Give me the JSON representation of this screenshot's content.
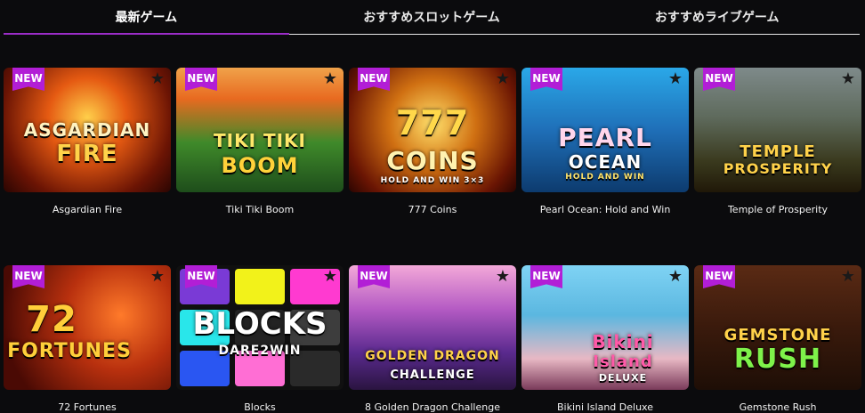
{
  "tabs": [
    {
      "label": "最新ゲーム",
      "active": true
    },
    {
      "label": "おすすめスロットゲーム",
      "active": false
    },
    {
      "label": "おすすめライブゲーム",
      "active": false
    }
  ],
  "badge_label": "NEW",
  "favorite_icon": "star-icon",
  "games": [
    {
      "title": "Asgardian Fire",
      "logo_line1": "ASGARDIAN",
      "logo_line2": "FIRE"
    },
    {
      "title": "Tiki Tiki Boom",
      "logo_line1": "TIKI TIKI",
      "logo_line2": "BOOM"
    },
    {
      "title": "777 Coins",
      "logo_line1": "777",
      "logo_line2": "COINS",
      "logo_line3": "HOLD AND WIN 3×3"
    },
    {
      "title": "Pearl Ocean: Hold and Win",
      "logo_line1": "PEARL",
      "logo_line2": "OCEAN",
      "logo_line3": "HOLD AND WIN"
    },
    {
      "title": "Temple of Prosperity",
      "logo_line1": "TEMPLE",
      "logo_line2": "PROSPERITY"
    },
    {
      "title": "72 Fortunes",
      "logo_line1": "72",
      "logo_line2": "FORTUNES"
    },
    {
      "title": "Blocks",
      "logo_line1": "BLOCKS",
      "logo_line2": "DARE2WIN"
    },
    {
      "title": "8 Golden Dragon Challenge",
      "logo_line1": "GOLDEN DRAGON",
      "logo_line2": "CHALLENGE"
    },
    {
      "title": "Bikini Island Deluxe",
      "logo_line1": "Bikini",
      "logo_line2": "Island",
      "logo_line3": "DELUXE"
    },
    {
      "title": "Gemstone Rush",
      "logo_line1": "GEMSTONE",
      "logo_line2": "RUSH"
    }
  ],
  "colors": {
    "accent": "#9b2dc8",
    "badge": "#b21ed6",
    "background": "#0b0b0d"
  }
}
